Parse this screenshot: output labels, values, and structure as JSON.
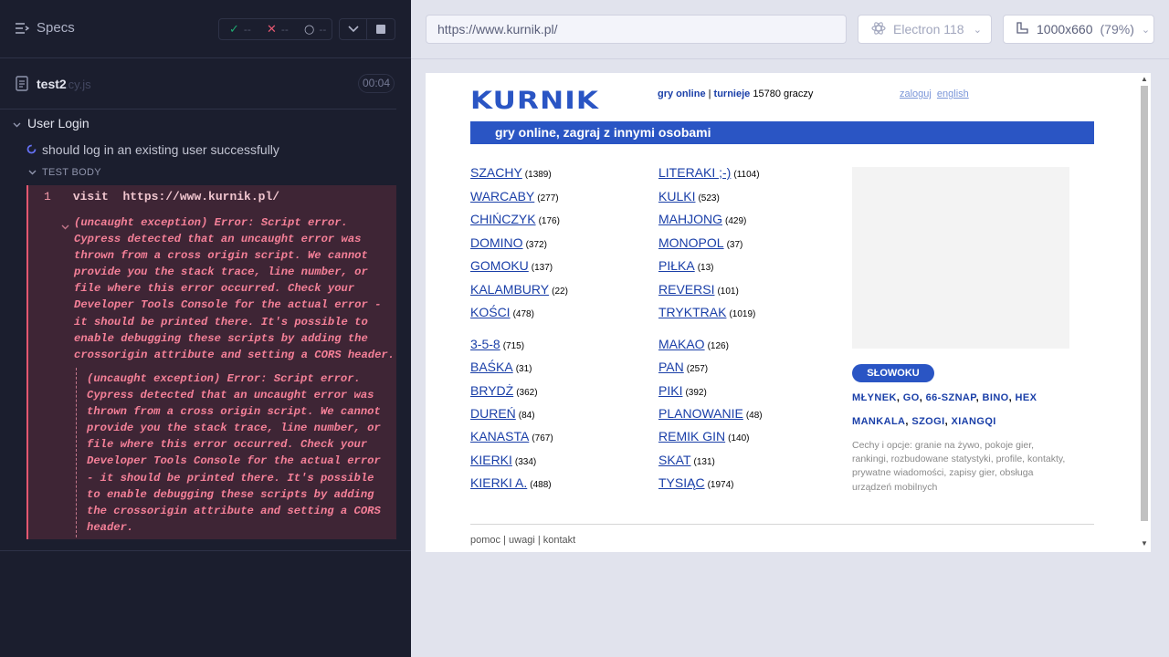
{
  "reporter": {
    "specs_label": "Specs",
    "stats": {
      "passed": "--",
      "failed": "--",
      "pending": "--"
    },
    "spec": {
      "name": "test2",
      "ext": ".cy.js",
      "duration": "00:04"
    },
    "suite": {
      "title": "User Login",
      "test": "should log in an existing user successfully",
      "body_label": "TEST BODY",
      "command": {
        "num": "1",
        "name": "visit",
        "arg": "https://www.kurnik.pl/"
      },
      "error_text": "(uncaught exception)  Error: Script error. Cypress detected that an uncaught error was thrown from a cross origin script. We cannot provide you the stack trace, line number, or file where this error occurred. Check your Developer Tools Console for the actual error - it should be printed there. It's possible to enable debugging these scripts by adding the crossorigin attribute and setting a CORS header."
    }
  },
  "toolbar": {
    "url": "https://www.kurnik.pl/",
    "browser": "Electron 118",
    "viewport": "1000x660",
    "scale": "(79%)"
  },
  "kurnik": {
    "logo": "KURNIK",
    "nav_gry": "gry online",
    "nav_sep": "|",
    "nav_turnieje": "turnieje",
    "players": "15780 graczy",
    "login": "zaloguj",
    "english": "english",
    "banner": "gry online, zagraj z innymi osobami",
    "games_left": [
      {
        "name": "SZACHY",
        "count": "(1389)"
      },
      {
        "name": "WARCABY",
        "count": "(277)"
      },
      {
        "name": "CHIŃCZYK",
        "count": "(176)"
      },
      {
        "name": "DOMINO",
        "count": "(372)"
      },
      {
        "name": "GOMOKU",
        "count": "(137)"
      },
      {
        "name": "KALAMBURY",
        "count": "(22)"
      },
      {
        "name": "KOŚCI",
        "count": "(478)"
      },
      {
        "name": "3-5-8",
        "count": "(715)"
      },
      {
        "name": "BAŚKA",
        "count": "(31)"
      },
      {
        "name": "BRYDŻ",
        "count": "(362)"
      },
      {
        "name": "DUREŃ",
        "count": "(84)"
      },
      {
        "name": "KANASTA",
        "count": "(767)"
      },
      {
        "name": "KIERKI",
        "count": "(334)"
      },
      {
        "name": "KIERKI A.",
        "count": "(488)"
      }
    ],
    "games_right": [
      {
        "name": "LITERAKI ;-)",
        "count": "(1104)"
      },
      {
        "name": "KULKI",
        "count": "(523)"
      },
      {
        "name": "MAHJONG",
        "count": "(429)"
      },
      {
        "name": "MONOPOL",
        "count": "(37)"
      },
      {
        "name": "PIŁKA",
        "count": "(13)"
      },
      {
        "name": "REVERSI",
        "count": "(101)"
      },
      {
        "name": "TRYKTRAK",
        "count": "(1019)"
      },
      {
        "name": "MAKAO",
        "count": "(126)"
      },
      {
        "name": "PAN",
        "count": "(257)"
      },
      {
        "name": "PIKI",
        "count": "(392)"
      },
      {
        "name": "PLANOWANIE",
        "count": "(48)"
      },
      {
        "name": "REMIK GIN",
        "count": "(140)"
      },
      {
        "name": "SKAT",
        "count": "(131)"
      },
      {
        "name": "TYSIĄC",
        "count": "(1974)"
      }
    ],
    "slowoku": "SŁOWOKU",
    "links_row1": [
      "MŁYNEK",
      "GO",
      "66-SZNAP",
      "BINO",
      "HEX"
    ],
    "links_row2": [
      "MANKALA",
      "SZOGI",
      "XIANGQI"
    ],
    "description": "Cechy i opcje: granie na żywo, pokoje gier, rankingi, rozbudowane statystyki, profile, kontakty, prywatne wiadomości, zapisy gier, obsługa urządzeń mobilnych",
    "footer": [
      "pomoc",
      "uwagi",
      "kontakt"
    ]
  }
}
